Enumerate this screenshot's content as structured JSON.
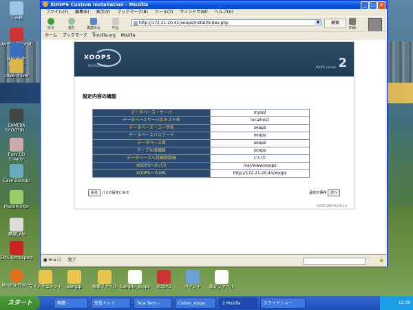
{
  "desktop": {
    "icons": [
      {
        "label": "ごみ箱"
      },
      {
        "label": "Adobe Acrobat"
      },
      {
        "label": "Microsoft Outlook"
      },
      {
        "label": "LhaArchiver"
      },
      {
        "label": "CAMERA SHOOTIN..."
      },
      {
        "label": "Easy CD Creator"
      },
      {
        "label": "Ease Backup"
      },
      {
        "label": "PhotoPrinter"
      },
      {
        "label": "無線LAN"
      },
      {
        "label": "EMC Retrospect"
      },
      {
        "label": "Mozilla Firefox"
      },
      {
        "label": "マイドキュメント"
      },
      {
        "label": "xampp"
      },
      {
        "label": "画像ファイル"
      },
      {
        "label": "Sample_xoops"
      },
      {
        "label": "XOOPS"
      },
      {
        "label": "ペイント"
      },
      {
        "label": "設定ファイル"
      }
    ]
  },
  "window": {
    "title": "XOOPS Custom Installation - Mozilla",
    "menu": [
      "ファイル(F)",
      "編集(E)",
      "表示(V)",
      "ブックマーク(B)",
      "ツール(T)",
      "ウィンドウ(W)",
      "ヘルプ(H)"
    ],
    "toolbar": {
      "back": "戻る",
      "forward": "進む",
      "reload": "再読み込み",
      "stop": "中止",
      "print": "印刷"
    },
    "url": "http://172.21.20.41/xoops/install/index.php",
    "search_label": "検索",
    "bookmarks": [
      "ホーム",
      "ブックマーク",
      "mozilla.org",
      "Mozilla"
    ],
    "status": "完了"
  },
  "page": {
    "logo": "XOOPS",
    "logo_sub": "INSTALLATION",
    "version_label": "XOOPS version",
    "version_num": "2",
    "title": "設定内容の確認",
    "rows": [
      {
        "key": "データベース・サーバ",
        "value": "mysql"
      },
      {
        "key": "データベースサーバのホスト名",
        "value": "localhost"
      },
      {
        "key": "データベース・ユーザ名",
        "value": "xoops"
      },
      {
        "key": "データベースパスワード",
        "value": "xoops"
      },
      {
        "key": "データベース名",
        "value": "xoops"
      },
      {
        "key": "テーブル接頭語",
        "value": "xoops"
      },
      {
        "key": "データベースへ持続的接続",
        "value": "いいえ"
      },
      {
        "key": "XOOPSへのパス",
        "value": "/var/www/xoops"
      },
      {
        "key": "XOOPSへのURL",
        "value": "http://172.21.20.41/xoops"
      }
    ],
    "back_btn": "戻る",
    "back_text": "パスの設定に戻る",
    "next_text": "設定の保存",
    "next_btn": "次へ",
    "footer": "XOOPS INSTALLER 2.0"
  },
  "taskbar": {
    "start": "スタート",
    "tasks": [
      "無題 -",
      "受信トレイ",
      "Tera Term - ",
      "Cebsn_xoops",
      "2 Mozilla",
      "スライドショー"
    ],
    "clock": "12:38"
  }
}
